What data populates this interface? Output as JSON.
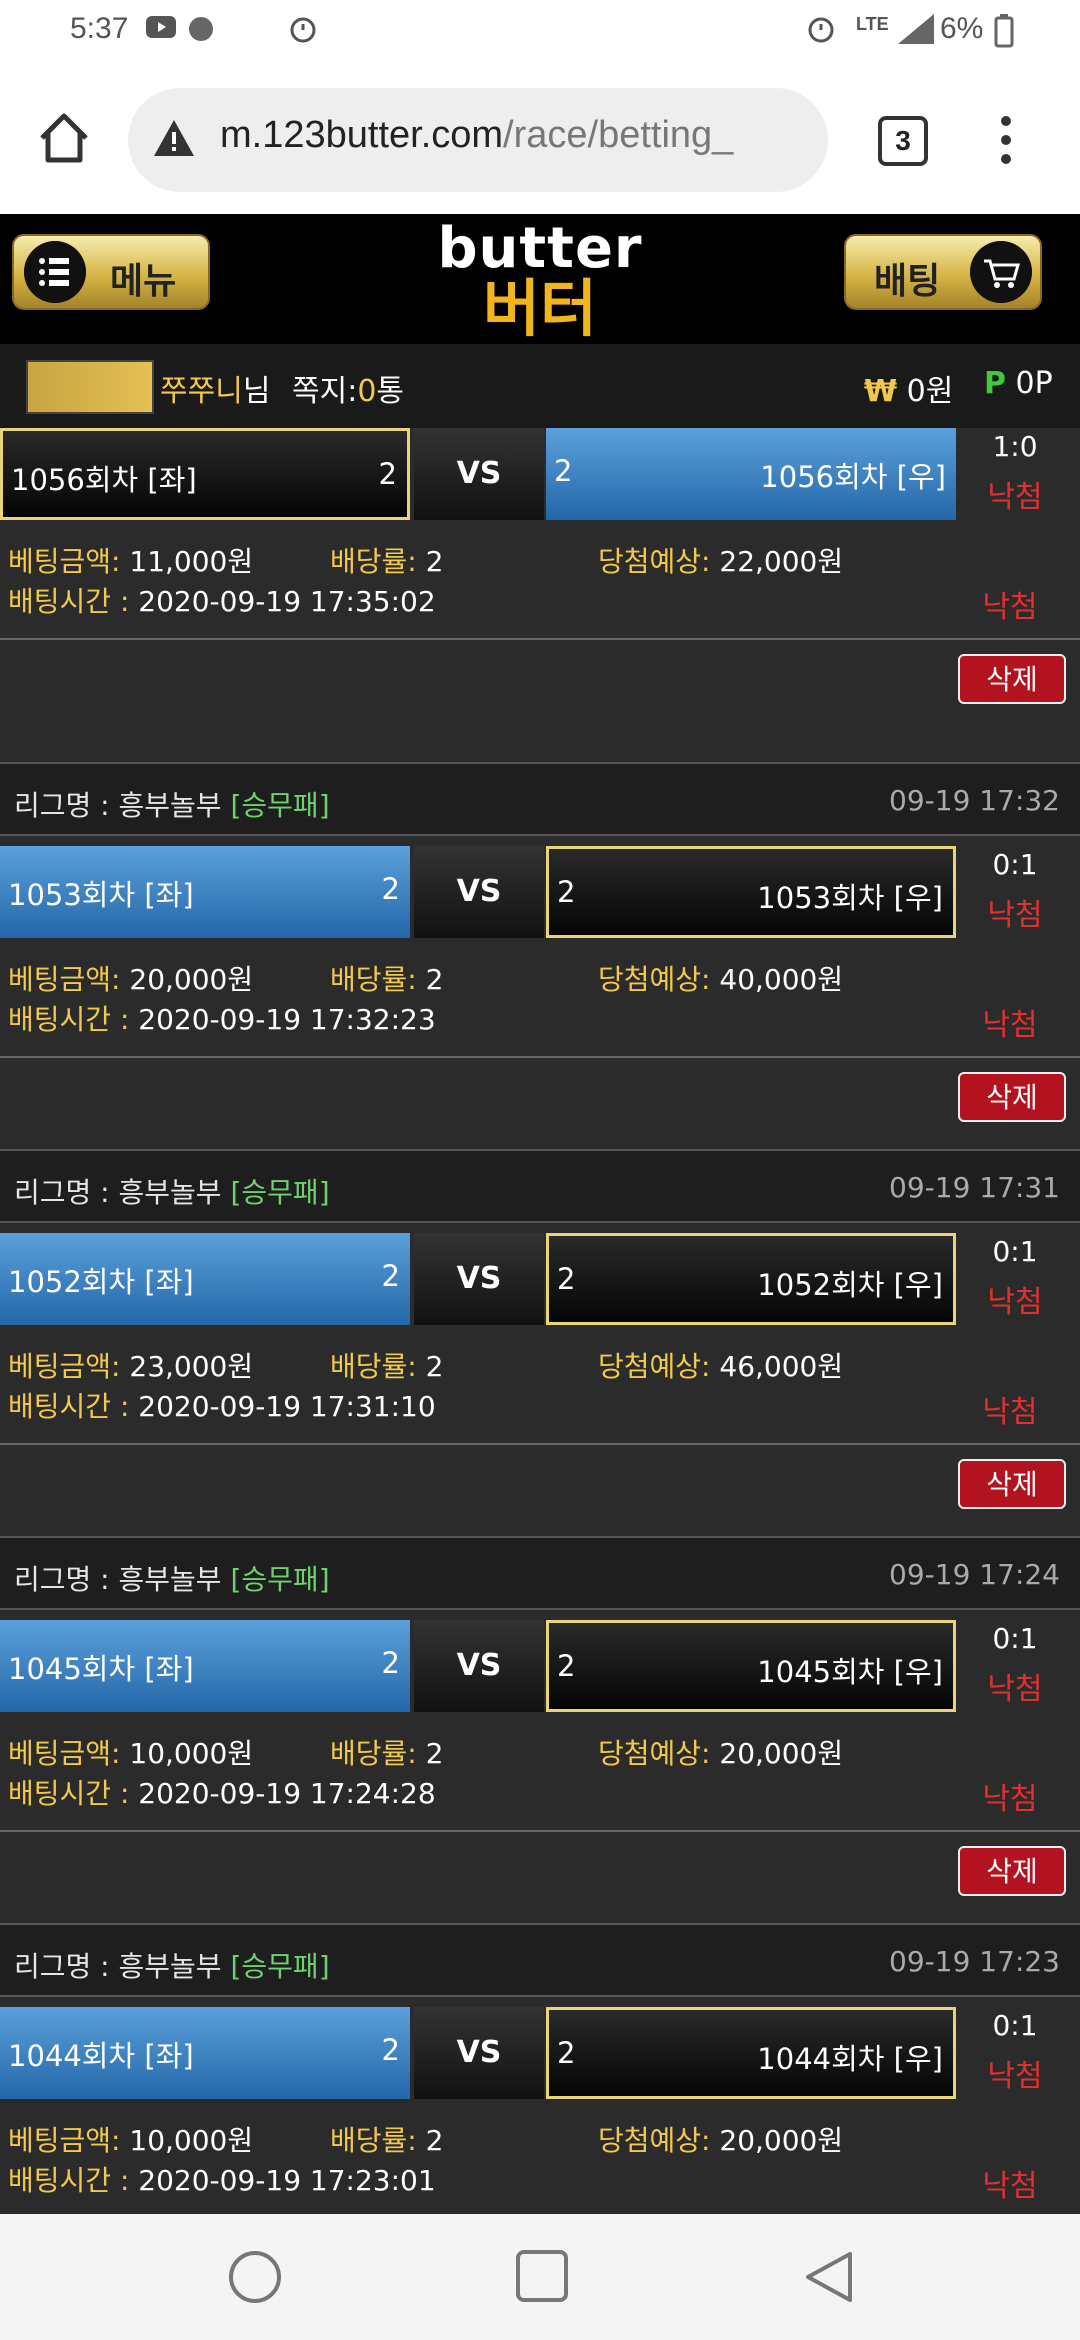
{
  "status": {
    "time": "5:37",
    "network": "LTE",
    "battery": "6%"
  },
  "browser": {
    "url_host": "m.123butter.com",
    "url_path": "/race/betting_",
    "tab_count": "3"
  },
  "header": {
    "menu_label": "메뉴",
    "bet_label": "배팅",
    "logo_en": "butter",
    "logo_ko": "버터"
  },
  "user": {
    "name": "쭈쭈니",
    "suffix": "님",
    "msg_label": "쪽지:",
    "msg_count": "0",
    "msg_unit": "통",
    "money_symbol": "₩",
    "money": "0원",
    "point_symbol": "P",
    "points": "0P"
  },
  "labels": {
    "vs": "VS",
    "bet_amount": "베팅금액:",
    "odds": "배당률:",
    "expected": "당첨예상:",
    "bet_time": "배팅시간 :",
    "lost": "낙첨",
    "delete": "삭제",
    "league": "리그명 :"
  },
  "bets": [
    {
      "league": "",
      "type": "",
      "time": "",
      "left_team": "1056회차 [좌]",
      "left_odds": "2",
      "right_team": "1056회차 [우]",
      "right_odds": "2",
      "selected": "right",
      "score": "1:0",
      "amount": "11,000원",
      "odds": "2",
      "expected": "22,000원",
      "bet_time": "2020-09-19 17:35:02"
    },
    {
      "league": "흥부놀부",
      "type": "[승무패]",
      "time": "09-19 17:32",
      "left_team": "1053회차 [좌]",
      "left_odds": "2",
      "right_team": "1053회차 [우]",
      "right_odds": "2",
      "selected": "left",
      "score": "0:1",
      "amount": "20,000원",
      "odds": "2",
      "expected": "40,000원",
      "bet_time": "2020-09-19 17:32:23"
    },
    {
      "league": "흥부놀부",
      "type": "[승무패]",
      "time": "09-19 17:31",
      "left_team": "1052회차 [좌]",
      "left_odds": "2",
      "right_team": "1052회차 [우]",
      "right_odds": "2",
      "selected": "left",
      "score": "0:1",
      "amount": "23,000원",
      "odds": "2",
      "expected": "46,000원",
      "bet_time": "2020-09-19 17:31:10"
    },
    {
      "league": "흥부놀부",
      "type": "[승무패]",
      "time": "09-19 17:24",
      "left_team": "1045회차 [좌]",
      "left_odds": "2",
      "right_team": "1045회차 [우]",
      "right_odds": "2",
      "selected": "left",
      "score": "0:1",
      "amount": "10,000원",
      "odds": "2",
      "expected": "20,000원",
      "bet_time": "2020-09-19 17:24:28"
    },
    {
      "league": "흥부놀부",
      "type": "[승무패]",
      "time": "09-19 17:23",
      "left_team": "1044회차 [좌]",
      "left_odds": "2",
      "right_team": "1044회차 [우]",
      "right_odds": "2",
      "selected": "left",
      "score": "0:1",
      "amount": "10,000원",
      "odds": "2",
      "expected": "20,000원",
      "bet_time": "2020-09-19 17:23:01"
    }
  ]
}
